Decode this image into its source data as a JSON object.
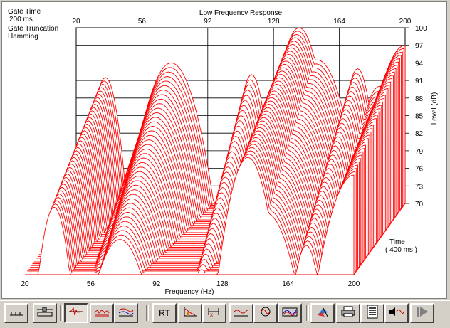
{
  "info": {
    "gate_time_label": "Gate Time",
    "gate_time_value": "200 ms",
    "gate_truncation_label": "Gate Truncation",
    "gate_truncation_value": "Hamming"
  },
  "chart_data": {
    "type": "waterfall",
    "title": "Low Frequency Response",
    "xlabel": "Frequency (Hz)",
    "ylabel": "Level (dB)",
    "zlabel_line1": "Time",
    "zlabel_line2": "( 400 ms )",
    "x_ticks": [
      "20",
      "56",
      "92",
      "128",
      "164",
      "200"
    ],
    "y_ticks": [
      "100",
      "97",
      "94",
      "91",
      "88",
      "85",
      "82",
      "79",
      "76",
      "73",
      "70"
    ],
    "xlim": [
      20,
      200
    ],
    "ylim": [
      70,
      100
    ],
    "time_range_ms": 400,
    "slice_count": 40,
    "series_color": "#ff0000",
    "peaks": [
      {
        "freq": 36,
        "level": 91.5
      },
      {
        "freq": 60,
        "level": 84
      },
      {
        "freq": 72,
        "level": 94
      },
      {
        "freq": 116,
        "level": 92
      },
      {
        "freq": 142,
        "level": 100
      },
      {
        "freq": 152,
        "level": 94.5
      },
      {
        "freq": 174,
        "level": 93
      },
      {
        "freq": 186,
        "level": 90
      },
      {
        "freq": 200,
        "level": 97
      }
    ]
  },
  "toolbar": {
    "buttons": [
      {
        "name": "axis-toggle-button",
        "icon": "axis-icon",
        "pressed": false
      },
      {
        "name": "slider-view-button",
        "icon": "slider-icon",
        "pressed": false
      },
      {
        "name": "impulse-view-button",
        "icon": "impulse-icon",
        "pressed": true
      },
      {
        "name": "waterfall-view-button",
        "icon": "waterfall-icon",
        "pressed": false
      },
      {
        "name": "multi-curve-button",
        "icon": "multi-curve-icon",
        "pressed": false
      },
      {
        "name": "rt-button",
        "icon": "rt-text",
        "label": "RT",
        "pressed": false
      },
      {
        "name": "decay-button",
        "icon": "decay-icon",
        "pressed": false
      },
      {
        "name": "gate-button",
        "icon": "gate-icon",
        "pressed": false
      },
      {
        "name": "frequency-response-button",
        "icon": "frequency-icon",
        "pressed": false
      },
      {
        "name": "phase-button",
        "icon": "phase-icon",
        "pressed": false
      },
      {
        "name": "spectrum-button",
        "icon": "spectrum-icon",
        "pressed": false
      },
      {
        "name": "color-button",
        "icon": "palette-icon",
        "pressed": false
      },
      {
        "name": "print-button",
        "icon": "printer-icon",
        "pressed": false
      },
      {
        "name": "report-button",
        "icon": "document-icon",
        "pressed": false
      },
      {
        "name": "speaker-button",
        "icon": "speaker-icon",
        "pressed": false
      },
      {
        "name": "next-button",
        "icon": "play-icon",
        "pressed": false
      }
    ]
  }
}
